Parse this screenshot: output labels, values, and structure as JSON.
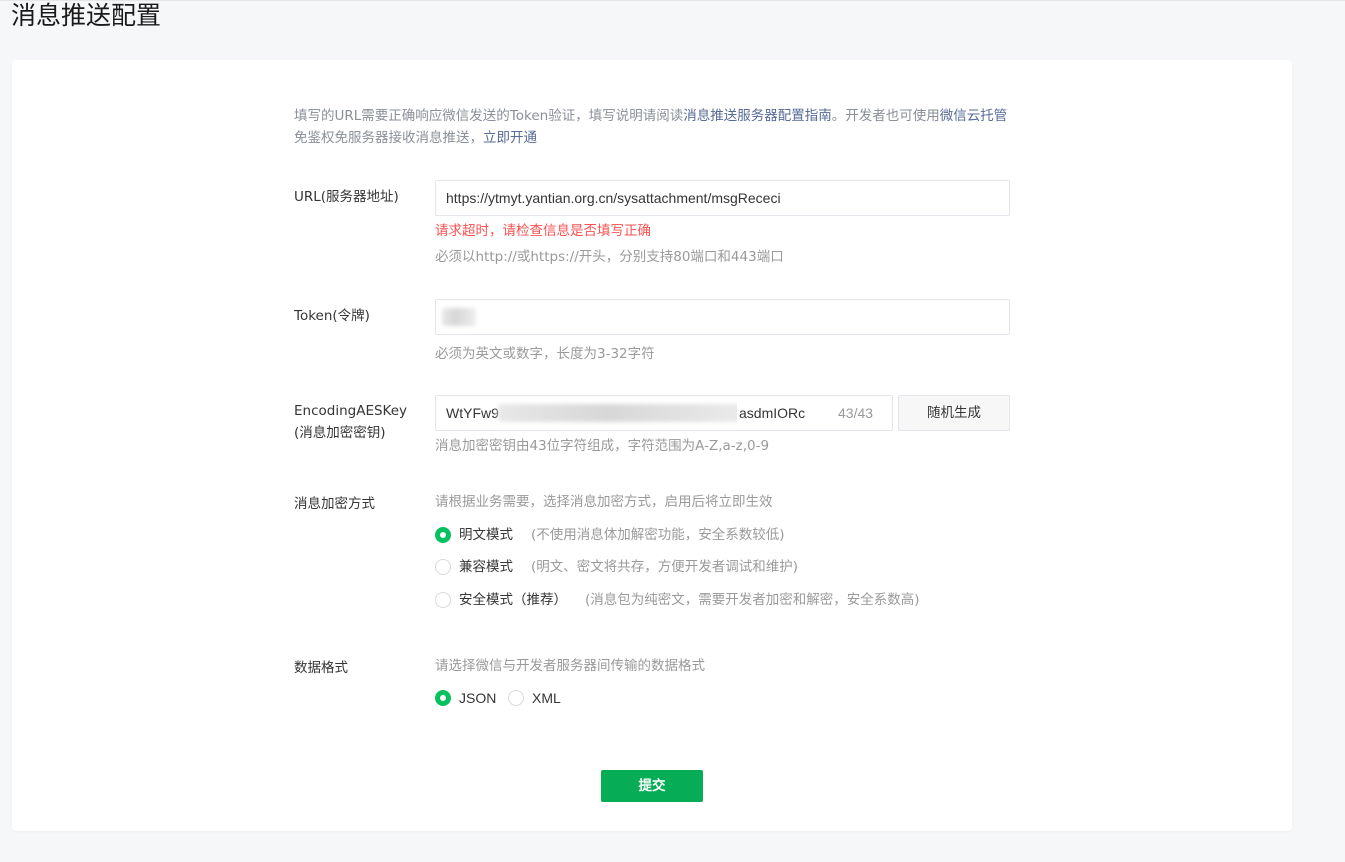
{
  "page": {
    "title": "消息推送配置"
  },
  "intro": {
    "text1": "填写的URL需要正确响应微信发送的Token验证，填写说明请阅读",
    "link1": "消息推送服务器配置指南",
    "text2": "。开发者也可使用",
    "link2": "微信云托管",
    "text3": "免鉴权免服务器接收消息推送，",
    "link3": "立即开通"
  },
  "url": {
    "label": "URL(服务器地址)",
    "value": "https://ytmyt.yantian.org.cn/sysattachment/msgRececi",
    "error": "请求超时，请检查信息是否填写正确",
    "tip": "必须以http://或https://开头，分别支持80端口和443端口"
  },
  "token": {
    "label": "Token(令牌)",
    "value": "",
    "tip": "必须为英文或数字，长度为3-32字符"
  },
  "aes": {
    "label_line1": "EncodingAESKey",
    "label_line2": "(消息加密密钥)",
    "value_prefix": "WtYFw9",
    "value_suffix": "asdmIORc",
    "count": "43/43",
    "generate_button": "随机生成",
    "tip": "消息加密密钥由43位字符组成，字符范围为A-Z,a-z,0-9"
  },
  "encrypt": {
    "label": "消息加密方式",
    "hint": "请根据业务需要，选择消息加密方式，启用后将立即生效",
    "options": [
      {
        "label": "明文模式",
        "desc": "(不使用消息体加解密功能，安全系数较低)",
        "checked": true
      },
      {
        "label": "兼容模式",
        "desc": "(明文、密文将共存，方便开发者调试和维护)",
        "checked": false
      },
      {
        "label": "安全模式（推荐）",
        "desc": "(消息包为纯密文，需要开发者加密和解密，安全系数高)",
        "checked": false
      }
    ]
  },
  "format": {
    "label": "数据格式",
    "hint": "请选择微信与开发者服务器间传输的数据格式",
    "options": [
      {
        "label": "JSON",
        "checked": true
      },
      {
        "label": "XML",
        "checked": false
      }
    ]
  },
  "submit": {
    "label": "提交"
  },
  "colors": {
    "accent": "#07c160",
    "link": "#576b95",
    "error": "#fa5151"
  }
}
